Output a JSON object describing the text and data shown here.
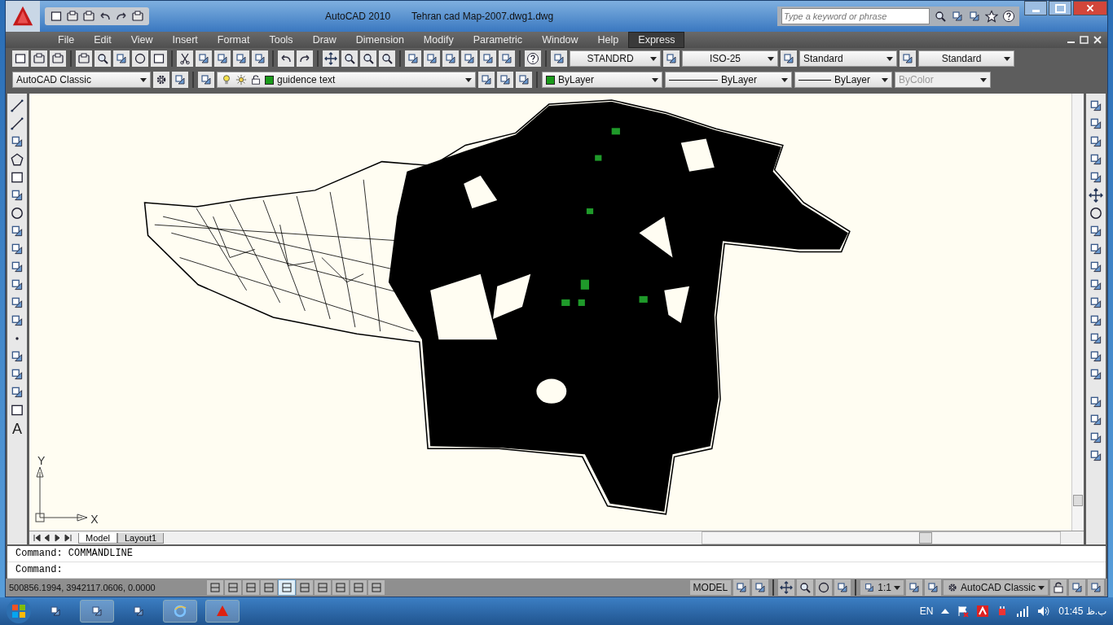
{
  "window": {
    "title": "AutoCAD 2010",
    "document": "Tehran cad Map-2007.dwg1.dwg"
  },
  "search": {
    "placeholder": "Type a keyword or phrase"
  },
  "menu": [
    {
      "label": "File",
      "selected": false
    },
    {
      "label": "Edit",
      "selected": false
    },
    {
      "label": "View",
      "selected": false
    },
    {
      "label": "Insert",
      "selected": false
    },
    {
      "label": "Format",
      "selected": false
    },
    {
      "label": "Tools",
      "selected": false
    },
    {
      "label": "Draw",
      "selected": false
    },
    {
      "label": "Dimension",
      "selected": false
    },
    {
      "label": "Modify",
      "selected": false
    },
    {
      "label": "Parametric",
      "selected": false
    },
    {
      "label": "Window",
      "selected": false
    },
    {
      "label": "Help",
      "selected": false
    },
    {
      "label": "Express",
      "selected": true
    }
  ],
  "styles": {
    "text_style": "STANDRD",
    "dim_style": "ISO-25",
    "table_style": "Standard",
    "multileader_style": "Standard"
  },
  "properties": {
    "workspace": "AutoCAD Classic",
    "layer": "guidence text",
    "color_control": "ByLayer",
    "linetype": "ByLayer",
    "lineweight": "ByLayer",
    "plot_style": {
      "value": "ByColor",
      "disabled": true
    }
  },
  "draw_toolbar": {
    "text_tool": "A"
  },
  "ucs": {
    "x": "X",
    "y": "Y"
  },
  "layout_tabs": [
    {
      "label": "Model",
      "selected": true
    },
    {
      "label": "Layout1",
      "selected": false
    }
  ],
  "command_lines": [
    "Command: COMMANDLINE",
    "Command:"
  ],
  "status": {
    "coordinates": "500856.1994, 3942117.0606, 0.0000",
    "space": "MODEL",
    "annotation_scale": "1:1",
    "workspace": "AutoCAD Classic"
  },
  "status_toggles": [
    {
      "on": false
    },
    {
      "on": false
    },
    {
      "on": false
    },
    {
      "on": false
    },
    {
      "on": true
    },
    {
      "on": false
    },
    {
      "on": false
    },
    {
      "on": false
    },
    {
      "on": false
    },
    {
      "on": false
    }
  ],
  "taskbar": {
    "language": "EN",
    "time": "ب.ظ 01:45"
  }
}
